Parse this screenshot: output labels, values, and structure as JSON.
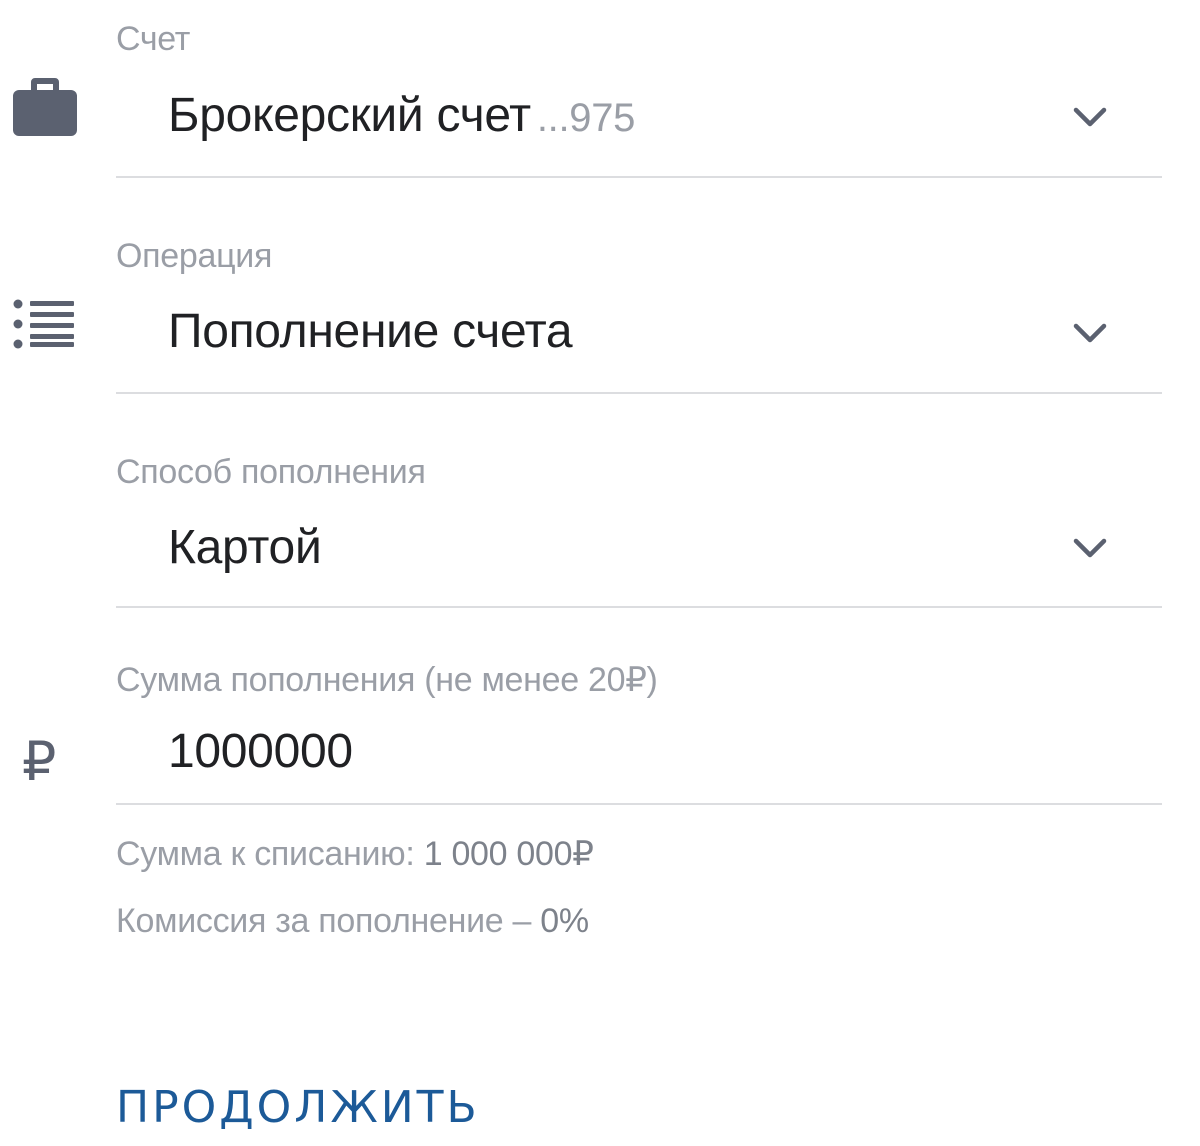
{
  "account": {
    "label": "Счет",
    "value": "Брокерский счет",
    "suffix": "...975",
    "icon": "briefcase-icon"
  },
  "operation": {
    "label": "Операция",
    "value": "Пополнение счета",
    "icon": "list-icon"
  },
  "method": {
    "label": "Способ пополнения",
    "value": "Картой"
  },
  "amount": {
    "label": "Сумма пополнения (не менее 20₽)",
    "value": "1000000",
    "icon": "ruble-icon",
    "icon_glyph": "₽"
  },
  "summary": {
    "debit_label": "Сумма к списанию: ",
    "debit_value": "1 000 000₽",
    "fee_label": "Комиссия за пополнение – ",
    "fee_value": "0%"
  },
  "continue_label": "ПРОДОЛЖИТЬ",
  "colors": {
    "accent": "#1c5a98",
    "icon": "#5b6170",
    "label": "#9a9ea6",
    "text": "#202124",
    "divider": "#dcdde0"
  }
}
